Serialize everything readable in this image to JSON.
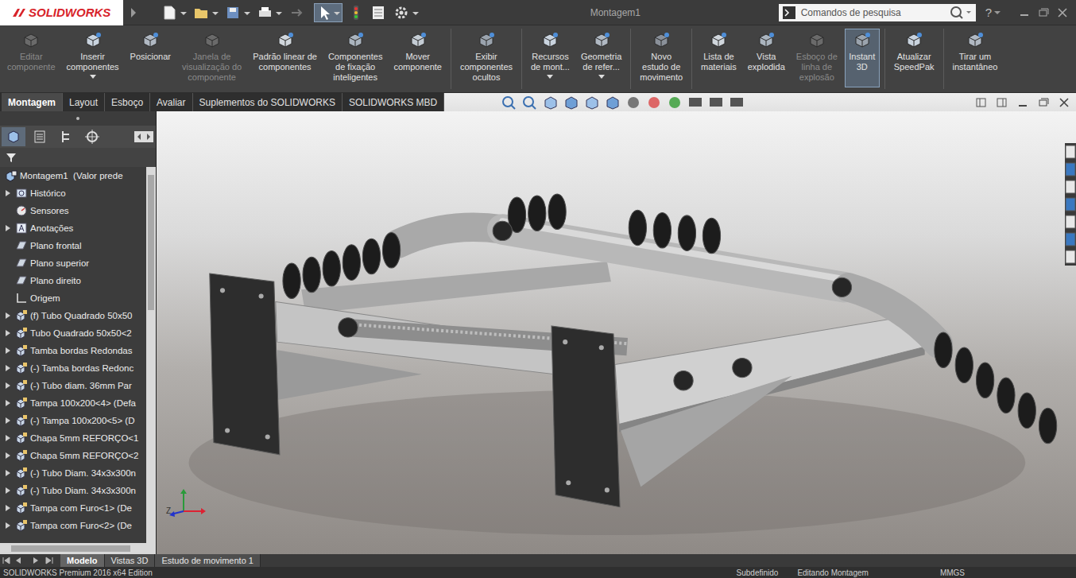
{
  "window": {
    "logo": "SOLIDWORKS",
    "title": "Montagem1"
  },
  "search": {
    "placeholder": "Comandos de pesquisa"
  },
  "help": "?",
  "ribbon": [
    {
      "lines": [
        "Editar",
        "componente"
      ],
      "group": 1,
      "disabled": true,
      "selected": false,
      "dropdown": false
    },
    {
      "lines": [
        "Inserir",
        "componentes"
      ],
      "group": 1,
      "disabled": false,
      "selected": false,
      "dropdown": true
    },
    {
      "lines": [
        "Posicionar"
      ],
      "group": 1,
      "disabled": false,
      "selected": false,
      "dropdown": false
    },
    {
      "lines": [
        "Janela de",
        "visualização do",
        "componente"
      ],
      "group": 1,
      "disabled": true,
      "selected": false,
      "dropdown": false
    },
    {
      "lines": [
        "Padrão linear de",
        "componentes"
      ],
      "group": 1,
      "disabled": false,
      "selected": false,
      "dropdown": false
    },
    {
      "lines": [
        "Componentes",
        "de fixação",
        "inteligentes"
      ],
      "group": 1,
      "disabled": false,
      "selected": false,
      "dropdown": false
    },
    {
      "lines": [
        "Mover",
        "componente"
      ],
      "group": 1,
      "disabled": false,
      "selected": false,
      "dropdown": false
    },
    {
      "lines": [
        "Exibir",
        "componentes",
        "ocultos"
      ],
      "group": 2,
      "disabled": false,
      "selected": false,
      "dropdown": false
    },
    {
      "lines": [
        "Recursos",
        "de mont..."
      ],
      "group": 3,
      "disabled": false,
      "selected": false,
      "dropdown": true
    },
    {
      "lines": [
        "Geometria",
        "de refer..."
      ],
      "group": 3,
      "disabled": false,
      "selected": false,
      "dropdown": true
    },
    {
      "lines": [
        "Novo",
        "estudo de",
        "movimento"
      ],
      "group": 4,
      "disabled": false,
      "selected": false,
      "dropdown": false
    },
    {
      "lines": [
        "Lista de",
        "materiais"
      ],
      "group": 5,
      "disabled": false,
      "selected": false,
      "dropdown": false
    },
    {
      "lines": [
        "Vista",
        "explodida"
      ],
      "group": 5,
      "disabled": false,
      "selected": false,
      "dropdown": false
    },
    {
      "lines": [
        "Esboço de",
        "linha de",
        "explosão"
      ],
      "group": 5,
      "disabled": true,
      "selected": false,
      "dropdown": false
    },
    {
      "lines": [
        "Instant",
        "3D"
      ],
      "group": 5,
      "disabled": false,
      "selected": true,
      "dropdown": false
    },
    {
      "lines": [
        "Atualizar",
        "SpeedPak"
      ],
      "group": 6,
      "disabled": false,
      "selected": false,
      "dropdown": false
    },
    {
      "lines": [
        "Tirar um",
        "instantâneo"
      ],
      "group": 7,
      "disabled": false,
      "selected": false,
      "dropdown": false
    }
  ],
  "tabs": [
    {
      "label": "Montagem",
      "selected": true
    },
    {
      "label": "Layout",
      "selected": false
    },
    {
      "label": "Esboço",
      "selected": false
    },
    {
      "label": "Avaliar",
      "selected": false
    },
    {
      "label": "Suplementos do SOLIDWORKS",
      "selected": false
    },
    {
      "label": "SOLIDWORKS MBD",
      "selected": false
    }
  ],
  "feature_tree": {
    "root": "Montagem1  (Valor prede",
    "items": [
      {
        "label": "Histórico",
        "kind": "history",
        "expandable": true
      },
      {
        "label": "Sensores",
        "kind": "sensor",
        "expandable": false
      },
      {
        "label": "Anotações",
        "kind": "annotation",
        "expandable": true
      },
      {
        "label": "Plano frontal",
        "kind": "plane",
        "expandable": false
      },
      {
        "label": "Plano superior",
        "kind": "plane",
        "expandable": false
      },
      {
        "label": "Plano direito",
        "kind": "plane",
        "expandable": false
      },
      {
        "label": "Origem",
        "kind": "origin",
        "expandable": false
      },
      {
        "label": "(f) Tubo Quadrado 50x50",
        "kind": "part",
        "expandable": true
      },
      {
        "label": "Tubo Quadrado 50x50<2",
        "kind": "part",
        "expandable": true
      },
      {
        "label": "Tamba bordas Redondas",
        "kind": "part",
        "expandable": true
      },
      {
        "label": "(-) Tamba bordas Redonc",
        "kind": "part",
        "expandable": true
      },
      {
        "label": "(-) Tubo diam. 36mm Par",
        "kind": "part",
        "expandable": true
      },
      {
        "label": "Tampa 100x200<4> (Defa",
        "kind": "part",
        "expandable": true
      },
      {
        "label": "(-) Tampa 100x200<5> (D",
        "kind": "part",
        "expandable": true
      },
      {
        "label": "Chapa 5mm REFORÇO<1",
        "kind": "part",
        "expandable": true
      },
      {
        "label": "Chapa 5mm REFORÇO<2",
        "kind": "part",
        "expandable": true
      },
      {
        "label": "(-) Tubo Diam. 34x3x300n",
        "kind": "part",
        "expandable": true
      },
      {
        "label": "(-) Tubo Diam. 34x3x300n",
        "kind": "part",
        "expandable": true
      },
      {
        "label": "Tampa com Furo<1> (De",
        "kind": "part",
        "expandable": true
      },
      {
        "label": "Tampa com Furo<2> (De",
        "kind": "part",
        "expandable": true
      }
    ]
  },
  "triad_label": "Z",
  "bottom_tabs": [
    {
      "label": "Modelo",
      "selected": true
    },
    {
      "label": "Vistas 3D",
      "selected": false
    },
    {
      "label": "Estudo de movimento 1",
      "selected": false
    }
  ],
  "status_bar": [
    "SOLIDWORKS Premium 2016 x64 Edition",
    "Subdefinido",
    "Editando Montagem",
    "MMGS"
  ]
}
